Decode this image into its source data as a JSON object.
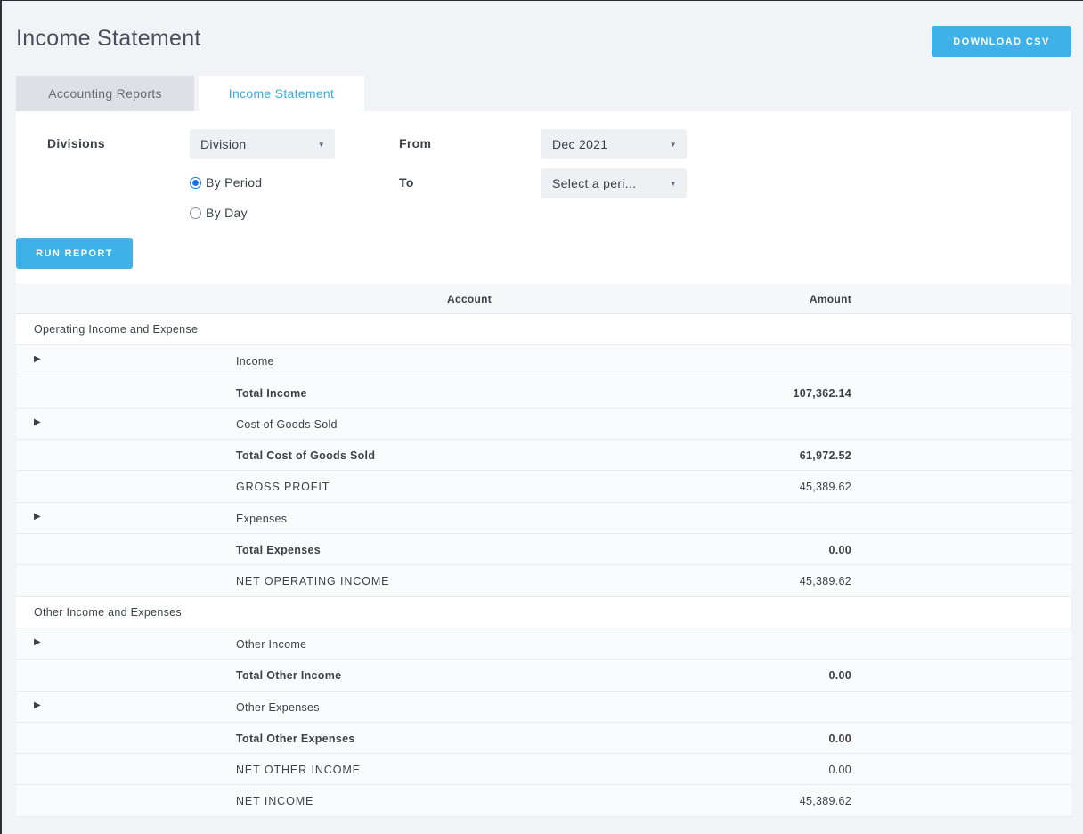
{
  "page": {
    "title": "Income Statement"
  },
  "toolbar": {
    "download_label": "DOWNLOAD CSV"
  },
  "tabs": [
    {
      "label": "Accounting Reports",
      "active": false
    },
    {
      "label": "Income Statement",
      "active": true
    }
  ],
  "filters": {
    "divisions_label": "Divisions",
    "division_select": "Division",
    "from_label": "From",
    "from_select": "Dec 2021",
    "to_label": "To",
    "to_select": "Select a peri...",
    "radio_by_period": "By Period",
    "radio_by_day": "By Day",
    "selected_mode": "By Period",
    "run_label": "RUN REPORT"
  },
  "table": {
    "headers": {
      "account": "Account",
      "amount": "Amount"
    },
    "rows": [
      {
        "type": "section",
        "label": "Operating Income and Expense"
      },
      {
        "type": "group",
        "account": "Income",
        "amount": ""
      },
      {
        "type": "total",
        "account": "Total Income",
        "amount": "107,362.14"
      },
      {
        "type": "group",
        "account": "Cost of Goods Sold",
        "amount": ""
      },
      {
        "type": "total",
        "account": "Total Cost of Goods Sold",
        "amount": "61,972.52"
      },
      {
        "type": "caps",
        "account": "GROSS PROFIT",
        "amount": "45,389.62"
      },
      {
        "type": "group",
        "account": "Expenses",
        "amount": ""
      },
      {
        "type": "total",
        "account": "Total Expenses",
        "amount": "0.00"
      },
      {
        "type": "caps",
        "account": "NET OPERATING INCOME",
        "amount": "45,389.62"
      },
      {
        "type": "section",
        "label": "Other Income and Expenses"
      },
      {
        "type": "group",
        "account": "Other Income",
        "amount": ""
      },
      {
        "type": "total",
        "account": "Total Other Income",
        "amount": "0.00"
      },
      {
        "type": "group",
        "account": "Other Expenses",
        "amount": ""
      },
      {
        "type": "total",
        "account": "Total Other Expenses",
        "amount": "0.00"
      },
      {
        "type": "caps",
        "account": "NET OTHER INCOME",
        "amount": "0.00"
      },
      {
        "type": "caps",
        "account": "NET INCOME",
        "amount": "45,389.62"
      }
    ]
  },
  "icons": {
    "expand": "triangle-right-icon",
    "caret": "caret-down-icon"
  },
  "colors": {
    "accent": "#3eb1e8",
    "active_tab_text": "#3aa7dc",
    "radio": "#1a73e8"
  }
}
